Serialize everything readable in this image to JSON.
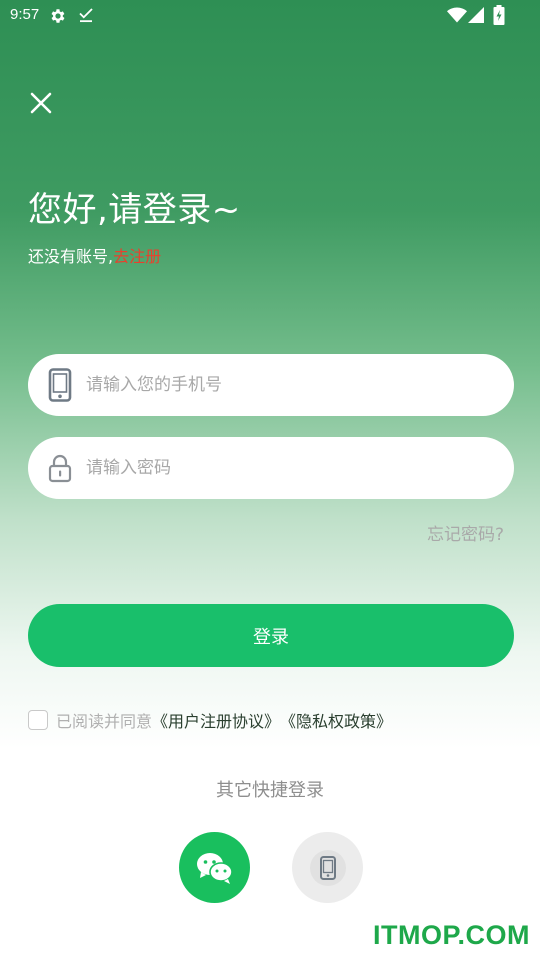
{
  "status_bar": {
    "time": "9:57",
    "icons": [
      "gear-icon",
      "download-done-icon",
      "wifi-icon",
      "signal-icon",
      "battery-icon"
    ]
  },
  "header": {
    "close_icon": "close-icon",
    "greeting": "您好,请登录~",
    "no_account": "还没有账号,",
    "register_link": "去注册"
  },
  "form": {
    "phone_placeholder": "请输入您的手机号",
    "phone_value": "",
    "password_placeholder": "请输入密码",
    "password_value": "",
    "forgot_password": "忘记密码?",
    "login_button": "登录"
  },
  "agreement": {
    "prefix": "已阅读并同意",
    "user_agreement": "《用户注册协议》",
    "privacy_policy": "《隐私权政策》",
    "checked": false
  },
  "quick_login": {
    "label": "其它快捷登录",
    "options": [
      "wechat-icon",
      "phone-icon"
    ]
  },
  "watermark": "ITMOP.COM",
  "colors": {
    "primary_green": "#19bf6b",
    "header_green": "#2e8f54",
    "register_red": "#e8412d",
    "wechat_green": "#19bf5e"
  }
}
